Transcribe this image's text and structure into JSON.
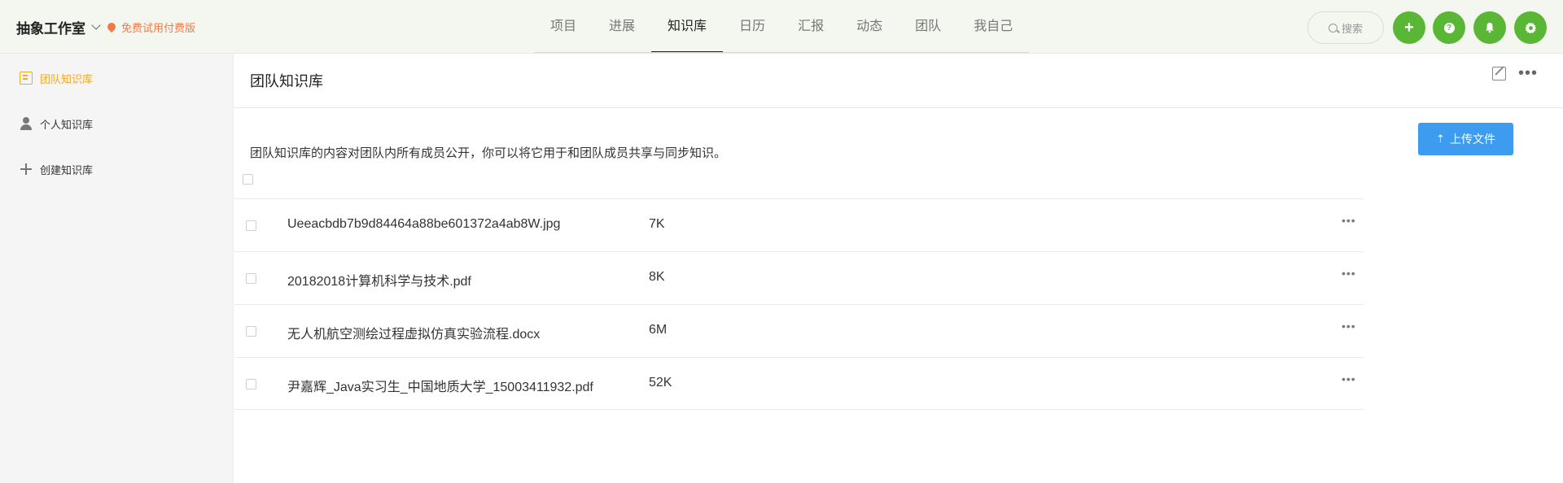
{
  "header": {
    "brand": "抽象工作室",
    "trial": "免费试用付费版",
    "nav": [
      {
        "label": "项目",
        "active": false
      },
      {
        "label": "进展",
        "active": false
      },
      {
        "label": "知识库",
        "active": true
      },
      {
        "label": "日历",
        "active": false
      },
      {
        "label": "汇报",
        "active": false
      },
      {
        "label": "动态",
        "active": false
      },
      {
        "label": "团队",
        "active": false
      },
      {
        "label": "我自己",
        "active": false
      }
    ],
    "search_label": "搜索",
    "buttons": {
      "add": "+",
      "help": "?",
      "bell": "bell-icon",
      "settings": "gear-icon"
    }
  },
  "sidebar": {
    "items": [
      {
        "label": "团队知识库",
        "active": true,
        "icon": "book-icon"
      },
      {
        "label": "个人知识库",
        "active": false,
        "icon": "user-icon"
      },
      {
        "label": "创建知识库",
        "active": false,
        "icon": "plus-icon"
      }
    ]
  },
  "main": {
    "title": "团队知识库",
    "description": "团队知识库的内容对团队内所有成员公开，你可以将它用于和团队成员共享与同步知识。",
    "upload_label": "上传文件",
    "files": [
      {
        "name": "Ueeacbdb7b9d84464a88be601372a4ab8W.jpg",
        "size": "7K"
      },
      {
        "name": "20182018计算机科学与技术.pdf",
        "size": "8K"
      },
      {
        "name": "无人机航空测绘过程虚拟仿真实验流程.docx",
        "size": "6M"
      },
      {
        "name": "尹嘉辉_Java实习生_中国地质大学_15003411932.pdf",
        "size": "52K"
      }
    ]
  },
  "colors": {
    "accent_green": "#5ab735",
    "trial_orange": "#f07b46",
    "sidebar_active": "#f5a623",
    "upload_blue": "#3d9bf0"
  }
}
